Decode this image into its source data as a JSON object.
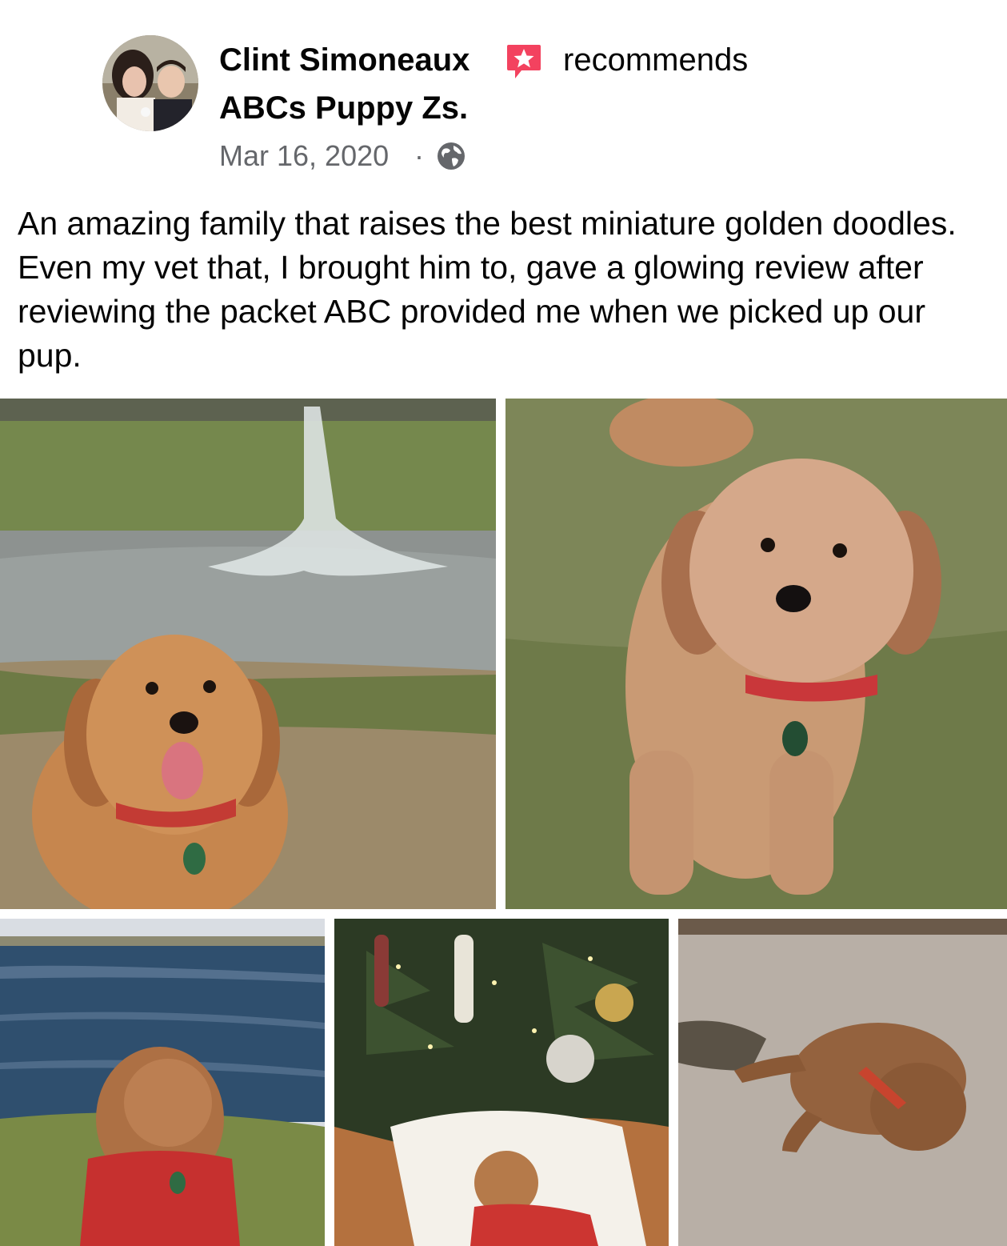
{
  "post": {
    "author": "Clint Simoneaux",
    "action": "recommends",
    "page": "ABCs Puppy Zs.",
    "date": "Mar 16, 2020",
    "separator": "·",
    "text": "An amazing family that raises the best miniature golden doodles. Even my vet that, I brought him to, gave a glowing review after reviewing the packet ABC provided me when we picked up our pup."
  },
  "icons": {
    "recommend": "recommend-star-badge-icon",
    "audience": "globe-icon"
  },
  "colors": {
    "recommend_badge": "#f3425f",
    "text_primary": "#050505",
    "text_secondary": "#65676b"
  },
  "photos": [
    {
      "name": "puppy-by-fountain-photo"
    },
    {
      "name": "puppy-on-grass-photo"
    },
    {
      "name": "puppy-by-lake-photo"
    },
    {
      "name": "puppy-under-christmas-tree-photo"
    },
    {
      "name": "puppy-sleeping-photo"
    }
  ]
}
